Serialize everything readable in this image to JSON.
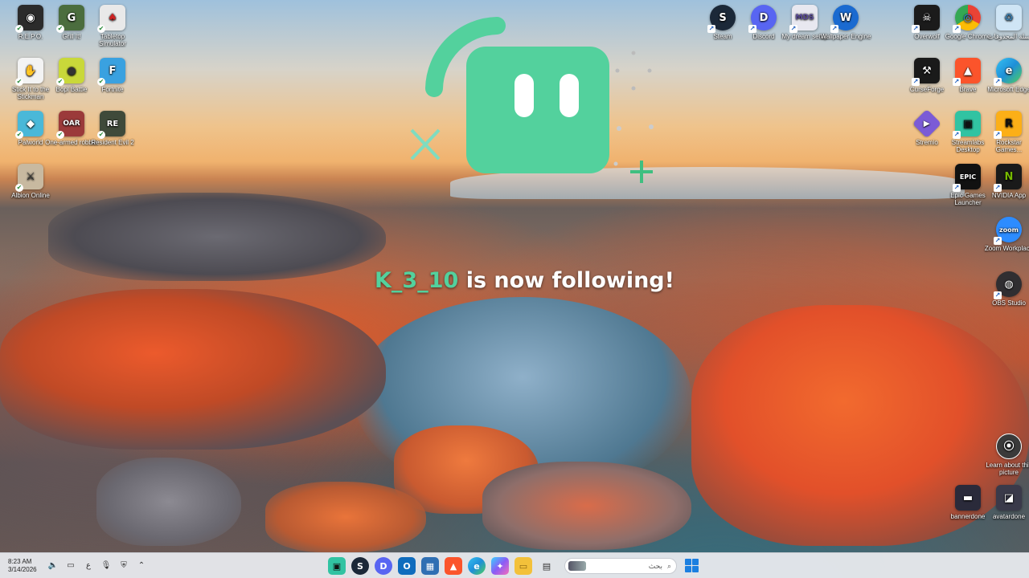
{
  "desktop": {
    "left_icons": [
      {
        "label": "R.E.P.O.",
        "glyph": "◉",
        "color": "#2b2b2b"
      },
      {
        "label": "Grill It!",
        "glyph": "G",
        "color": "#4b6d3e"
      },
      {
        "label": "Tabletop Simulator",
        "glyph": "♠",
        "color": "#e9e9e9"
      },
      {
        "label": "Stick It to the Stickman",
        "glyph": "✋",
        "color": "#f3f3f3"
      },
      {
        "label": "Bopl Battle",
        "glyph": "●",
        "color": "#c9d83a"
      },
      {
        "label": "Fortnite",
        "glyph": "F",
        "color": "#3aa1e0"
      },
      {
        "label": "Palworld",
        "glyph": "◆",
        "color": "#4ab8d8"
      },
      {
        "label": "One-armed robber",
        "glyph": "OAR",
        "color": "#9b3a3a"
      },
      {
        "label": "Resident Evil 2",
        "glyph": "RE",
        "color": "#3f4a3a"
      },
      {
        "label": "Albion Online",
        "glyph": "⚔",
        "color": "#c8b9a0"
      }
    ],
    "top_icons": [
      {
        "label": "Steam",
        "glyph": "S",
        "color": "#1b2838"
      },
      {
        "label": "Discord",
        "glyph": "D",
        "color": "#5865f2"
      },
      {
        "label": "My dream setup",
        "glyph": "MDS",
        "color": "#e8e8f0"
      },
      {
        "label": "Wallpaper Engine",
        "glyph": "W",
        "color": "#1a6ad0"
      }
    ],
    "right_icons": [
      {
        "label": "Overwolf",
        "glyph": "☠",
        "color": "#1b1b1b"
      },
      {
        "label": "Google Chrome",
        "glyph": "◎",
        "color": "#ea4335"
      },
      {
        "label": "سلة المحذوفات",
        "glyph": "♻",
        "color": "#cfe5f5"
      },
      {
        "label": "CurseForge",
        "glyph": "⚒",
        "color": "#1a1a1a"
      },
      {
        "label": "Brave",
        "glyph": "▲",
        "color": "#fb542b"
      },
      {
        "label": "Microsoft Edge",
        "glyph": "e",
        "color": "#1f8fd8"
      },
      {
        "label": "Stremio",
        "glyph": "▶",
        "color": "#7b5bd6"
      },
      {
        "label": "Streamlabs Desktop",
        "glyph": "▣",
        "color": "#31c3a2"
      },
      {
        "label": "Rockstar Games...",
        "glyph": "R",
        "color": "#fcaf17"
      },
      {
        "label": "Epic Games Launcher",
        "glyph": "EPIC",
        "color": "#111111"
      },
      {
        "label": "NVIDIA App",
        "glyph": "N",
        "color": "#76b900"
      },
      {
        "label": "Zoom Workplace",
        "glyph": "zoom",
        "color": "#2d8cff"
      },
      {
        "label": "OBS Studio",
        "glyph": "◍",
        "color": "#302e31"
      },
      {
        "label": "Learn about this picture",
        "glyph": "⦿",
        "color": "#3a3a3a"
      },
      {
        "label": "bannerdone",
        "glyph": "▬",
        "color": "#2a2a3a"
      },
      {
        "label": "avatardone",
        "glyph": "◪",
        "color": "#3a3a4a"
      }
    ]
  },
  "alert": {
    "username": "K_3_10",
    "message": " is now following!",
    "accent": "#53d19d"
  },
  "taskbar": {
    "time": "8:23 AM",
    "date": "3/14/2026",
    "tray_icons": [
      "speaker-icon",
      "display-icon",
      "language-indicator",
      "mic-icon",
      "security-icon",
      "chevron-up-icon"
    ],
    "language": "ع",
    "search_placeholder": "بحث",
    "apps": [
      {
        "name": "streamlabs",
        "glyph": "▣",
        "color": "#31c3a2"
      },
      {
        "name": "steam",
        "glyph": "S",
        "color": "#1b2838"
      },
      {
        "name": "discord",
        "glyph": "D",
        "color": "#5865f2"
      },
      {
        "name": "outlook",
        "glyph": "O",
        "color": "#0f6cbd"
      },
      {
        "name": "store",
        "glyph": "▦",
        "color": "#2f6fb3"
      },
      {
        "name": "brave",
        "glyph": "▲",
        "color": "#fb542b"
      },
      {
        "name": "edge",
        "glyph": "e",
        "color": "#1f8fd8"
      },
      {
        "name": "copilot",
        "glyph": "✦",
        "color": "#8a5cf6"
      },
      {
        "name": "file-explorer",
        "glyph": "▭",
        "color": "#f3c13a"
      },
      {
        "name": "task-view",
        "glyph": "▤",
        "color": "#3a3a3a"
      }
    ]
  }
}
